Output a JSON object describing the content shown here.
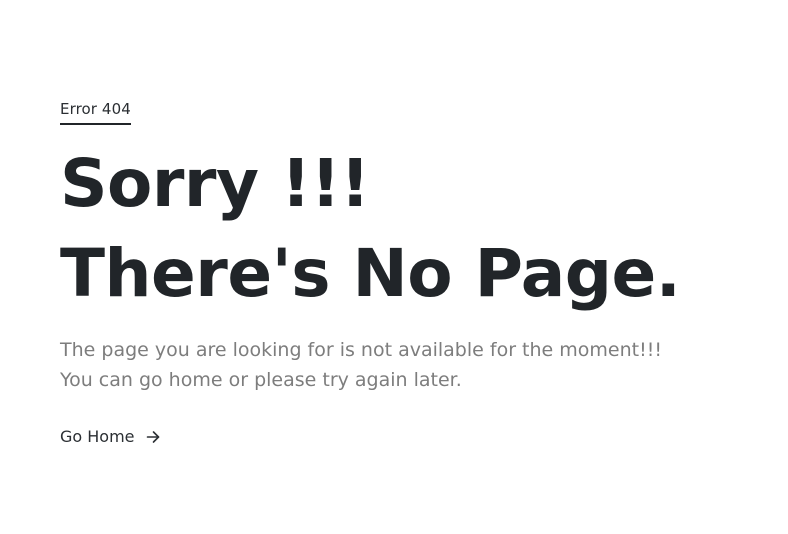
{
  "error": {
    "label": "Error 404"
  },
  "headline": {
    "line1": "Sorry !!!",
    "line2": "There's No Page."
  },
  "description": {
    "line1": "The page you are looking for is not available for the moment!!!",
    "line2": "You can go home or please try again later."
  },
  "action": {
    "label": "Go Home",
    "icon": "arrow-right-icon"
  },
  "colors": {
    "text": "#212529",
    "muted": "#7d7d7d",
    "background": "#ffffff"
  }
}
